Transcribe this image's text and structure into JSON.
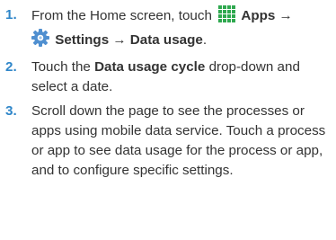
{
  "colors": {
    "step_number": "#2f86c9",
    "text": "#333333",
    "apps_icon": "#2fa84f",
    "settings_icon": "#4f8fd0"
  },
  "icons": {
    "apps": "apps-grid-icon",
    "settings": "settings-gear-icon"
  },
  "steps": [
    {
      "number": "1.",
      "t1": "From the Home screen, touch ",
      "b1": "Apps",
      "a1": " →",
      "b2": "Settings",
      "a2": " → ",
      "b3": "Data usage",
      "t2": "."
    },
    {
      "number": "2.",
      "t1": "Touch the ",
      "b1": "Data usage cycle",
      "t2": " drop-down and select a date."
    },
    {
      "number": "3.",
      "text": "Scroll down the page to see the processes or apps using mobile data service. Touch a process or app to see data usage for the process or app, and to configure specific settings."
    }
  ]
}
